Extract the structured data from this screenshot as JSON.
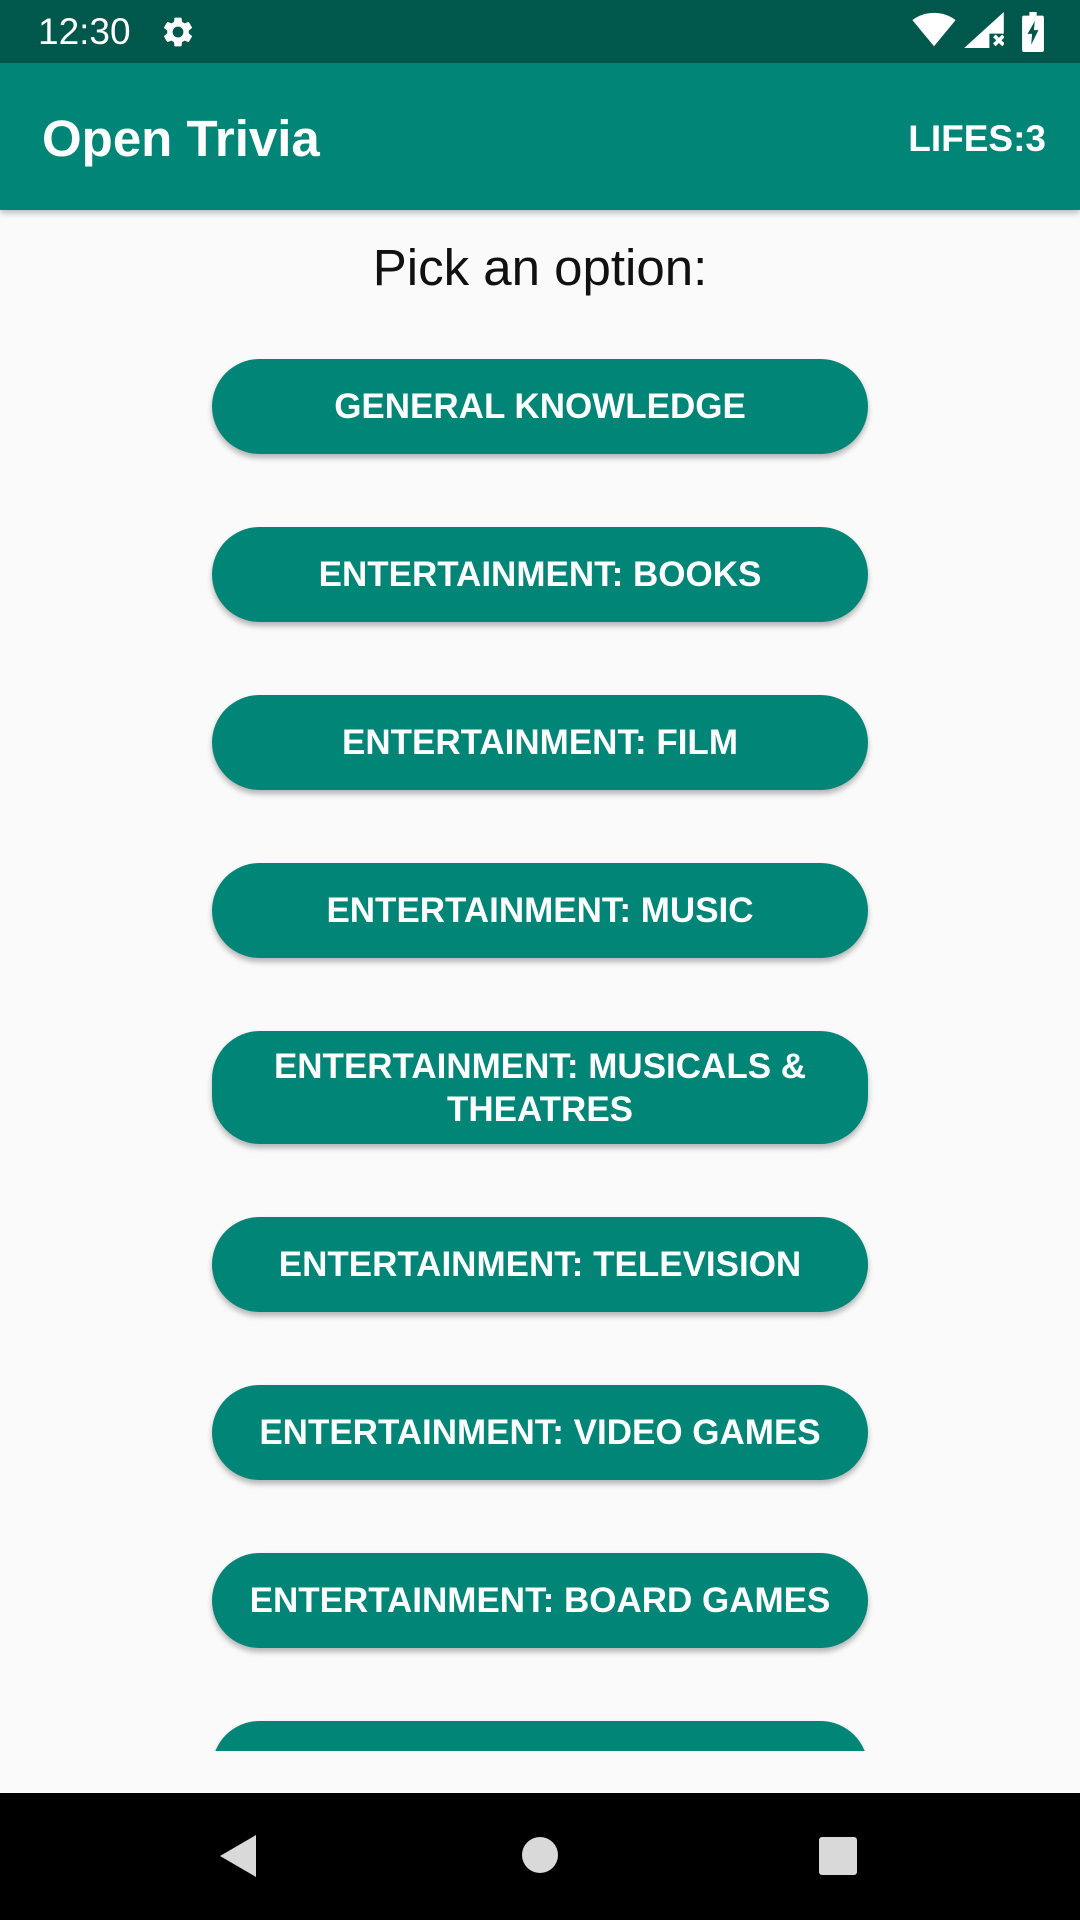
{
  "status_bar": {
    "time": "12:30",
    "icons": [
      "settings-icon",
      "wifi-icon",
      "signal-icon",
      "battery-charging-icon"
    ]
  },
  "app_bar": {
    "title": "Open Trivia",
    "lifes": "LIFES:3"
  },
  "main": {
    "prompt": "Pick an option:",
    "categories": [
      {
        "label": "GENERAL KNOWLEDGE"
      },
      {
        "label": "ENTERTAINMENT: BOOKS"
      },
      {
        "label": "ENTERTAINMENT: FILM"
      },
      {
        "label": "ENTERTAINMENT: MUSIC"
      },
      {
        "label": "ENTERTAINMENT: MUSICALS & THEATRES"
      },
      {
        "label": "ENTERTAINMENT: TELEVISION"
      },
      {
        "label": "ENTERTAINMENT: VIDEO GAMES"
      },
      {
        "label": "ENTERTAINMENT: BOARD GAMES"
      },
      {
        "label": ""
      }
    ]
  },
  "nav_bar": {
    "icons": [
      "back-icon",
      "home-icon",
      "recents-icon"
    ]
  },
  "colors": {
    "primary": "#008577",
    "primary_dark": "#00574b",
    "background": "#fafafa"
  }
}
